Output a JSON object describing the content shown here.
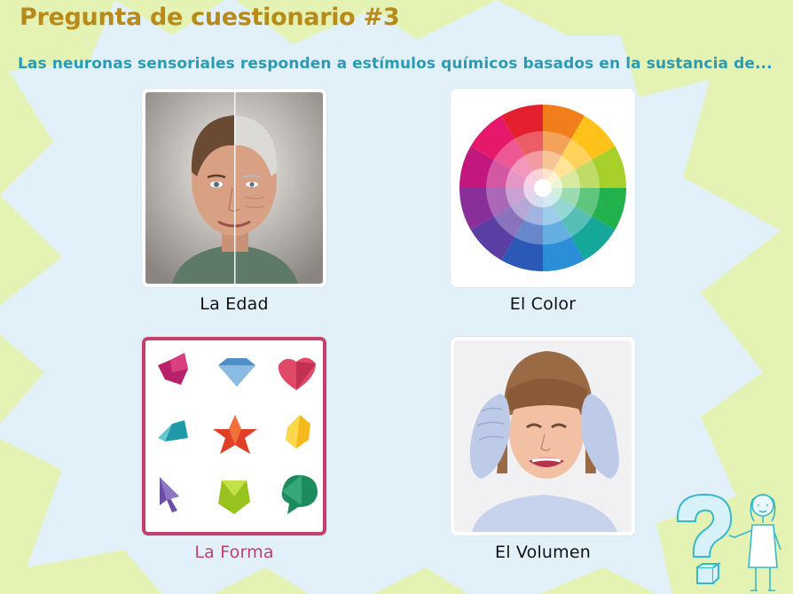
{
  "quiz": {
    "title": "Pregunta de cuestionario #3",
    "question": "Las neuronas sensoriales responden a estímulos químicos basados en la sustancia de...",
    "colors": {
      "title": "#b88a1a",
      "question": "#2a9bb5",
      "label": "#111111",
      "selected_label": "#c2406a",
      "selected_border": "#c2406a",
      "background": "#e4f3b3",
      "burst": "#e2f1f9"
    },
    "options": [
      {
        "label": "La Edad",
        "image": "aging-face-image",
        "selected": false
      },
      {
        "label": "El Color",
        "image": "color-wheel-image",
        "selected": false
      },
      {
        "label": "La Forma",
        "image": "origami-shapes-image",
        "selected": true
      },
      {
        "label": "El Volumen",
        "image": "girl-covering-ears-image",
        "selected": false
      }
    ],
    "decoration": "question-mark-character-icon"
  }
}
